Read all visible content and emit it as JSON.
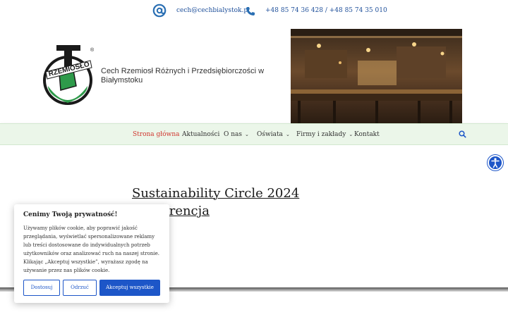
{
  "topbar": {
    "email": "cech@cechbialystok.pl",
    "phones": "+48 85 74 36 428 / +48 85 74 35 010",
    "email_icon": "at-icon",
    "phone_icon": "phone-icon"
  },
  "header": {
    "logo_text": "RZEMIOSŁO",
    "logo_mark": "®",
    "org_name": "Cech Rzemiosł Różnych i Przedsiębiorczości w Białymstoku"
  },
  "nav": {
    "items": [
      {
        "label": "Strona główna",
        "active": true,
        "dropdown": false
      },
      {
        "label": "Aktualności",
        "active": false,
        "dropdown": false
      },
      {
        "label": "O nas",
        "active": false,
        "dropdown": true
      },
      {
        "label": "Oświata",
        "active": false,
        "dropdown": true
      },
      {
        "label": "Firmy i zakłady",
        "active": false,
        "dropdown": true
      },
      {
        "label": "Kontakt",
        "active": false,
        "dropdown": false
      }
    ],
    "search_icon": "search-icon"
  },
  "main": {
    "post_title": "Sustainability Circle 2024 Konferencja"
  },
  "cookie": {
    "title": "Cenimy Twoją prywatność!",
    "text": "Używamy plików cookie, aby poprawić jakość przeglądania, wyświetlać spersonalizowane reklamy lub treści dostosowane do indywidualnych potrzeb użytkowników oraz analizować ruch na naszej stronie. Klikając „Akceptuj wszystkie”, wyrażasz zgodę na używanie przez nas plików cookie.",
    "btn_customize": "Dostosuj",
    "btn_reject": "Odrzuć",
    "btn_accept": "Akceptuj wszystkie"
  },
  "colors": {
    "brand_blue": "#1d56c8",
    "nav_bg": "#ebf6e9",
    "active_red": "#d0362f",
    "logo_green": "#2e9a4a"
  }
}
